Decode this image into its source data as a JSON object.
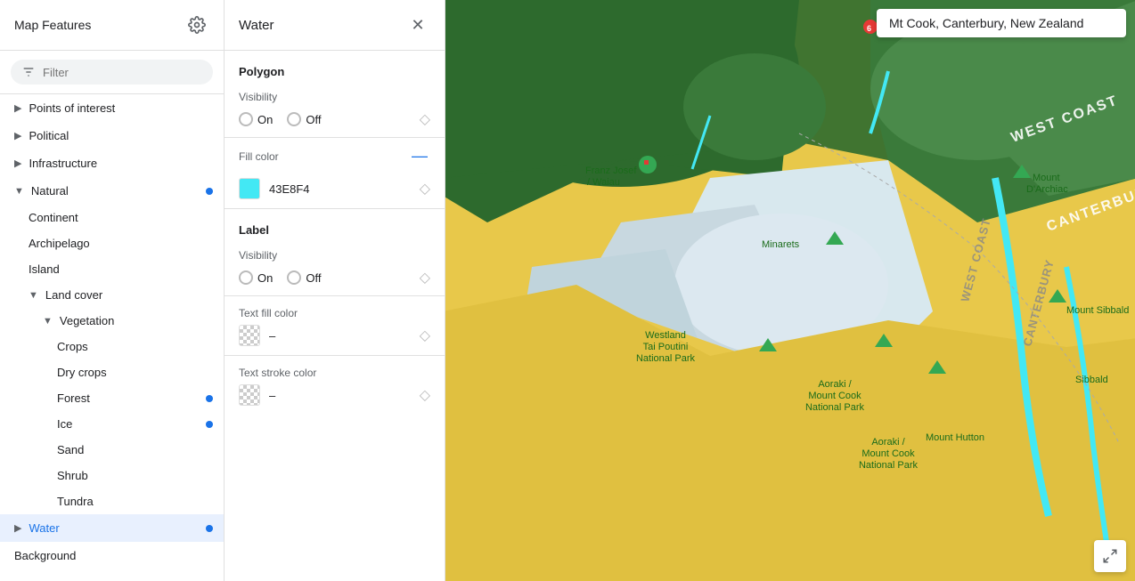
{
  "leftPanel": {
    "title": "Map Features",
    "filterPlaceholder": "Filter",
    "navItems": [
      {
        "id": "points-of-interest",
        "label": "Points of interest",
        "level": 0,
        "expandable": true,
        "hasDot": false
      },
      {
        "id": "political",
        "label": "Political",
        "level": 0,
        "expandable": true,
        "hasDot": false
      },
      {
        "id": "infrastructure",
        "label": "Infrastructure",
        "level": 0,
        "expandable": true,
        "hasDot": false
      },
      {
        "id": "natural",
        "label": "Natural",
        "level": 0,
        "expanded": true,
        "expandable": true,
        "hasDot": true
      },
      {
        "id": "continent",
        "label": "Continent",
        "level": 1,
        "expandable": false,
        "hasDot": false
      },
      {
        "id": "archipelago",
        "label": "Archipelago",
        "level": 1,
        "expandable": false,
        "hasDot": false
      },
      {
        "id": "island",
        "label": "Island",
        "level": 1,
        "expandable": false,
        "hasDot": false
      },
      {
        "id": "land-cover",
        "label": "Land cover",
        "level": 1,
        "expanded": true,
        "expandable": true,
        "hasDot": false
      },
      {
        "id": "vegetation",
        "label": "Vegetation",
        "level": 2,
        "expanded": true,
        "expandable": true,
        "hasDot": false
      },
      {
        "id": "crops",
        "label": "Crops",
        "level": 3,
        "expandable": false,
        "hasDot": false
      },
      {
        "id": "dry-crops",
        "label": "Dry crops",
        "level": 3,
        "expandable": false,
        "hasDot": false
      },
      {
        "id": "forest",
        "label": "Forest",
        "level": 3,
        "expandable": false,
        "hasDot": true
      },
      {
        "id": "ice",
        "label": "Ice",
        "level": 3,
        "expandable": false,
        "hasDot": true
      },
      {
        "id": "sand",
        "label": "Sand",
        "level": 3,
        "expandable": false,
        "hasDot": false
      },
      {
        "id": "shrub",
        "label": "Shrub",
        "level": 3,
        "expandable": false,
        "hasDot": false
      },
      {
        "id": "tundra",
        "label": "Tundra",
        "level": 3,
        "expandable": false,
        "hasDot": false
      },
      {
        "id": "water",
        "label": "Water",
        "level": 0,
        "expandable": true,
        "active": true,
        "hasDot": true
      },
      {
        "id": "background",
        "label": "Background",
        "level": 0,
        "expandable": false,
        "hasDot": false
      }
    ]
  },
  "midPanel": {
    "title": "Water",
    "polygon": {
      "sectionTitle": "Polygon",
      "visibilityLabel": "Visibility",
      "onLabel": "On",
      "offLabel": "Off",
      "fillColorLabel": "Fill color",
      "fillColorValue": "43E8F4",
      "fillColorHex": "#43E8F4"
    },
    "label": {
      "sectionTitle": "Label",
      "visibilityLabel": "Visibility",
      "onLabel": "On",
      "offLabel": "Off",
      "textFillLabel": "Text fill color",
      "textFillValue": "–",
      "textStrokeLabel": "Text stroke color",
      "textStrokeValue": "–"
    }
  },
  "map": {
    "searchValue": "Mt Cook, Canterbury, New Zealand"
  }
}
